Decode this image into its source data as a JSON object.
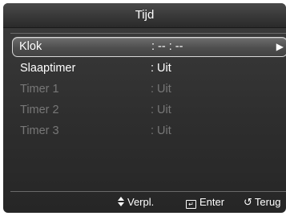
{
  "header": {
    "title": "Tijd"
  },
  "menu": {
    "items": [
      {
        "label": "Klok",
        "value": ": -- : --",
        "selected": true,
        "enabled": true,
        "has_submenu": true
      },
      {
        "label": "Slaaptimer",
        "value": ": Uit",
        "selected": false,
        "enabled": true,
        "has_submenu": false
      },
      {
        "label": "Timer 1",
        "value": ": Uit",
        "selected": false,
        "enabled": false,
        "has_submenu": false
      },
      {
        "label": "Timer 2",
        "value": ": Uit",
        "selected": false,
        "enabled": false,
        "has_submenu": false
      },
      {
        "label": "Timer 3",
        "value": ": Uit",
        "selected": false,
        "enabled": false,
        "has_submenu": false
      }
    ]
  },
  "footer": {
    "move_label": "Verpl.",
    "enter_label": "Enter",
    "return_label": "Terug"
  },
  "icons": {
    "submenu_arrow": "arrow-right-icon",
    "move": "updown-arrows-icon",
    "enter": "enter-icon",
    "return": "return-icon"
  },
  "colors": {
    "enabled_text": "#ffffff",
    "disabled_text": "#777777",
    "highlight_border": "#d8d8d8"
  }
}
